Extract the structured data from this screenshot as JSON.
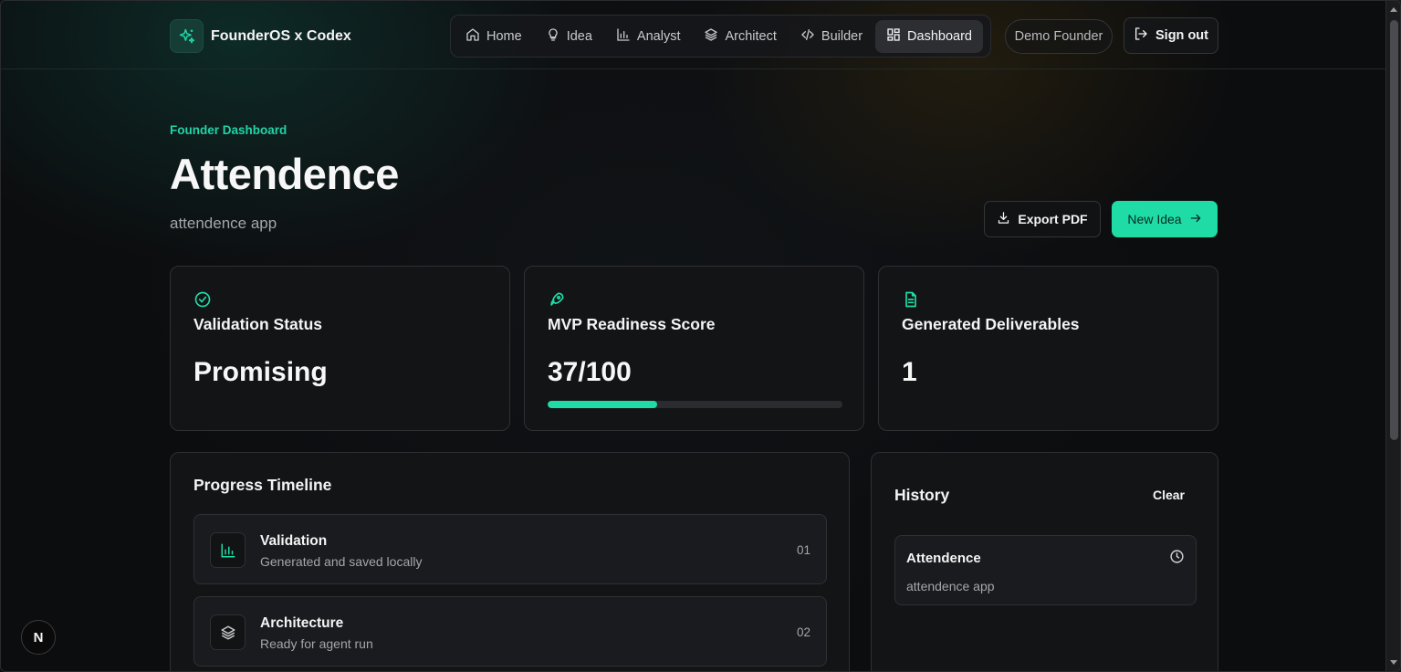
{
  "brand": {
    "name": "FounderOS x Codex"
  },
  "nav": {
    "items": [
      {
        "label": "Home",
        "icon": "home-icon"
      },
      {
        "label": "Idea",
        "icon": "lightbulb-icon"
      },
      {
        "label": "Analyst",
        "icon": "bar-chart-icon"
      },
      {
        "label": "Architect",
        "icon": "layers-icon"
      },
      {
        "label": "Builder",
        "icon": "code-icon"
      },
      {
        "label": "Dashboard",
        "icon": "dashboard-icon",
        "active": true
      }
    ]
  },
  "header": {
    "user": "Demo Founder",
    "signout_label": "Sign out"
  },
  "hero": {
    "eyebrow": "Founder Dashboard",
    "title": "Attendence",
    "subtitle": "attendence app",
    "export_label": "Export PDF",
    "new_idea_label": "New Idea"
  },
  "stats": {
    "validation": {
      "label": "Validation Status",
      "value": "Promising"
    },
    "mvp": {
      "label": "MVP Readiness Score",
      "value": "37/100",
      "progress": 37
    },
    "deliverables": {
      "label": "Generated Deliverables",
      "value": "1"
    }
  },
  "timeline": {
    "title": "Progress Timeline",
    "items": [
      {
        "title": "Validation",
        "subtitle": "Generated and saved locally",
        "num": "01"
      },
      {
        "title": "Architecture",
        "subtitle": "Ready for agent run",
        "num": "02"
      }
    ]
  },
  "history": {
    "title": "History",
    "clear_label": "Clear",
    "items": [
      {
        "name": "Attendence",
        "subtitle": "attendence app"
      }
    ]
  },
  "badge": {
    "letter": "N"
  },
  "colors": {
    "accent": "#1fdca7",
    "eyebrow": "#22d3a6",
    "background": "#0c0d0f",
    "card": "#131416"
  }
}
